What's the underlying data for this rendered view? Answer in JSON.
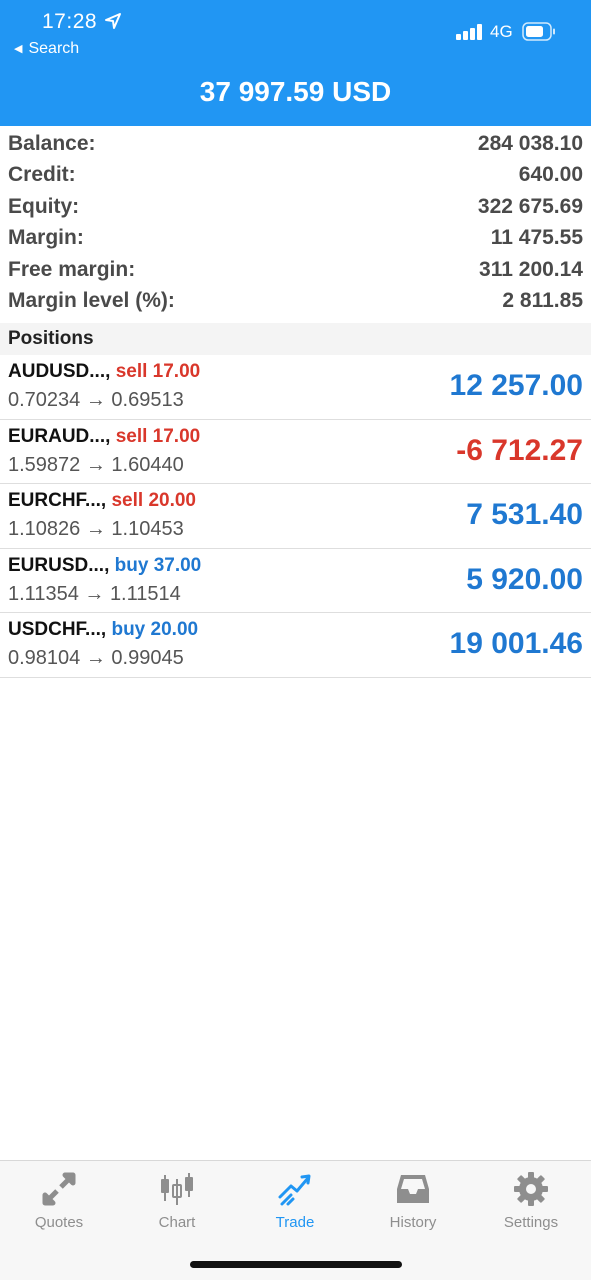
{
  "status_bar": {
    "time": "17:28",
    "back_label": "Search",
    "network": "4G"
  },
  "header": {
    "title": "37 997.59 USD"
  },
  "summary": [
    {
      "label": "Balance:",
      "value": "284 038.10"
    },
    {
      "label": "Credit:",
      "value": "640.00"
    },
    {
      "label": "Equity:",
      "value": "322 675.69"
    },
    {
      "label": "Margin:",
      "value": "11 475.55"
    },
    {
      "label": "Free margin:",
      "value": "311 200.14"
    },
    {
      "label": "Margin level (%):",
      "value": "2 811.85"
    }
  ],
  "positions": {
    "title": "Positions",
    "items": [
      {
        "symbol": "AUDUSD...,",
        "side": "sell 17.00",
        "open": "0.70234",
        "arrow": "→",
        "current": "0.69513",
        "profit": "12 257.00"
      },
      {
        "symbol": "EURAUD...,",
        "side": "sell 17.00",
        "open": "1.59872",
        "arrow": "→",
        "current": "1.60440",
        "profit": "-6 712.27"
      },
      {
        "symbol": "EURCHF...,",
        "side": "sell 20.00",
        "open": "1.10826",
        "arrow": "→",
        "current": "1.10453",
        "profit": "7 531.40"
      },
      {
        "symbol": "EURUSD...,",
        "side": "buy 37.00",
        "open": "1.11354",
        "arrow": "→",
        "current": "1.11514",
        "profit": "5 920.00"
      },
      {
        "symbol": "USDCHF...,",
        "side": "buy 20.00",
        "open": "0.98104",
        "arrow": "→",
        "current": "0.99045",
        "profit": "19 001.46"
      }
    ]
  },
  "tabbar": {
    "items": [
      {
        "label": "Quotes",
        "icon": "quotes-icon"
      },
      {
        "label": "Chart",
        "icon": "chart-icon"
      },
      {
        "label": "Trade",
        "icon": "trade-icon",
        "active": true
      },
      {
        "label": "History",
        "icon": "history-icon"
      },
      {
        "label": "Settings",
        "icon": "settings-icon"
      }
    ]
  },
  "colors": {
    "accent": "#2196f3",
    "sell": "#d9372b",
    "buy": "#1f78d1",
    "inactive_tab": "#8e8e8e"
  }
}
